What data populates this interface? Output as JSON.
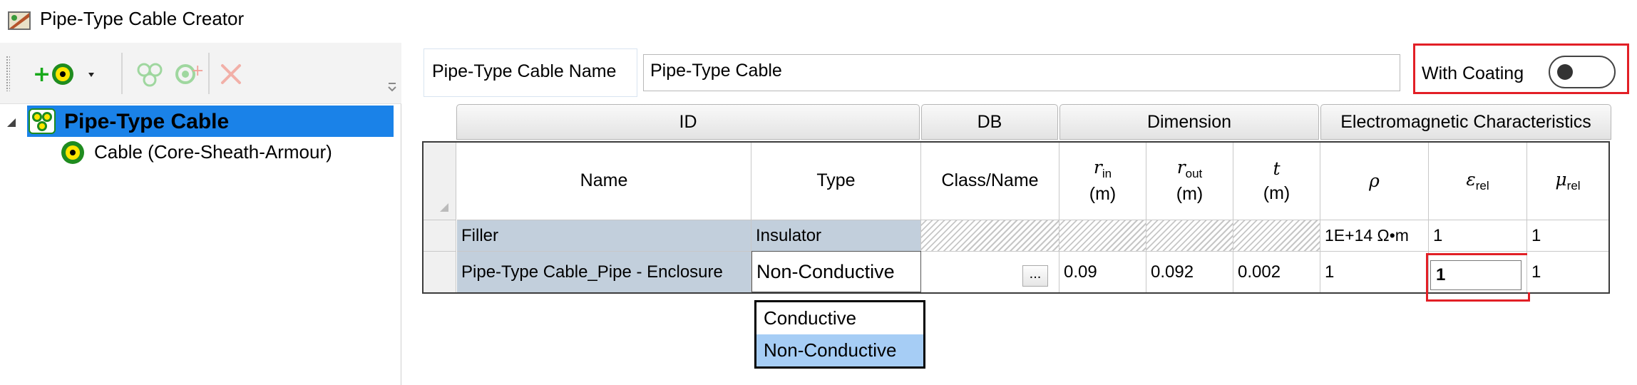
{
  "window": {
    "title": "Pipe-Type Cable Creator",
    "app_icon": "cable-creator-icon"
  },
  "toolbar": {
    "add_icon": "add-cable-icon",
    "add_dropdown_icon": "chevron-down-icon",
    "tool_icons": [
      "add-conductors-icon",
      "add-item-icon",
      "delete-icon"
    ],
    "overflow_icon": "toolbar-overflow-icon"
  },
  "tree": {
    "root": {
      "label": "Pipe-Type Cable",
      "icon": "pipe-type-cable-icon"
    },
    "children": [
      {
        "label": "Cable (Core-Sheath-Armour)",
        "icon": "cable-icon"
      }
    ]
  },
  "form": {
    "name_label": "Pipe-Type Cable Name",
    "name_value": "Pipe-Type Cable"
  },
  "coating": {
    "label": "With Coating",
    "enabled": false
  },
  "grid": {
    "groups": [
      "ID",
      "DB",
      "Dimension",
      "Electromagnetic Characteristics"
    ],
    "columns": {
      "name": "Name",
      "type": "Type",
      "class_name": "Class/Name",
      "r_in": {
        "symbol": "r",
        "sub": "in",
        "unit": "(m)"
      },
      "r_out": {
        "symbol": "r",
        "sub": "out",
        "unit": "(m)"
      },
      "t": {
        "symbol": "t",
        "unit": "(m)"
      },
      "rho": {
        "symbol": "ρ"
      },
      "eps": {
        "symbol": "ε",
        "sub": "rel"
      },
      "mu": {
        "symbol": "μ",
        "sub": "rel"
      }
    },
    "rows": [
      {
        "name": "Filler",
        "type": "Insulator",
        "rho": "1E+14 Ω•m",
        "eps": "1",
        "mu": "1"
      },
      {
        "name": "Pipe-Type Cable_Pipe - Enclosure",
        "type": "Non-Conductive",
        "class_button": "...",
        "r_in": "0.09",
        "r_out": "0.092",
        "t": "0.002",
        "rho": "1",
        "eps": "1",
        "mu": "1"
      }
    ]
  },
  "type_dropdown": {
    "options": [
      "Conductive",
      "Non-Conductive"
    ],
    "selected": "Non-Conductive"
  },
  "colors": {
    "selection": "#1a82e8",
    "highlight": "#e21f26",
    "readonly_cell": "#c2cfdc",
    "dropdown_selected": "#a6cdf5"
  }
}
